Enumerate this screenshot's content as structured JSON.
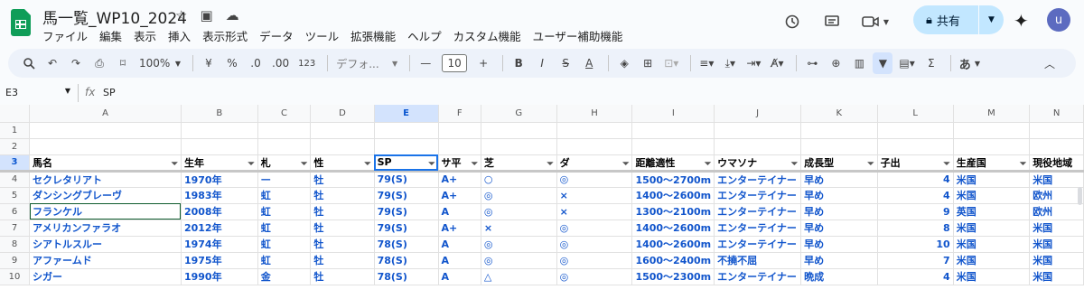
{
  "doc": {
    "title": "馬一覧_WP10_2024"
  },
  "menu": [
    "ファイル",
    "編集",
    "表示",
    "挿入",
    "表示形式",
    "データ",
    "ツール",
    "拡張機能",
    "ヘルプ",
    "カスタム機能",
    "ユーザー補助機能"
  ],
  "share": {
    "label": "共有"
  },
  "user": {
    "initial": "u"
  },
  "toolbar": {
    "zoom": "100%",
    "currency": "¥",
    "percent": "%",
    "dec_less": ".0",
    "dec_more": ".00",
    "number_format": "123",
    "font": "デフォ...",
    "font_size": "10",
    "bold": "B",
    "italic": "I",
    "strike": "S",
    "text_color": "A",
    "input_tool": "あ"
  },
  "formula": {
    "cell": "E3",
    "fx": "fx",
    "value": "SP"
  },
  "columns": [
    "A",
    "B",
    "C",
    "D",
    "E",
    "F",
    "G",
    "H",
    "I",
    "J",
    "K",
    "L",
    "M",
    "N"
  ],
  "row_numbers": [
    "1",
    "2",
    "3",
    "4",
    "5",
    "6",
    "7",
    "8",
    "9",
    "10"
  ],
  "headers": [
    "馬名",
    "生年",
    "札",
    "性",
    "SP",
    "サ平",
    "芝",
    "ダ",
    "距離適性",
    "ウマソナ",
    "成長型",
    "子出",
    "生産国",
    "現役地域"
  ],
  "rows": [
    [
      "セクレタリアト",
      "1970年",
      "—",
      "牡",
      "79(S)",
      "A+",
      "○",
      "◎",
      "1500〜2700m",
      "エンターテイナー",
      "早め",
      "4",
      "米国",
      "米国"
    ],
    [
      "ダンシングブレーヴ",
      "1983年",
      "虹",
      "牡",
      "79(S)",
      "A+",
      "◎",
      "×",
      "1400〜2600m",
      "エンターテイナー",
      "早め",
      "4",
      "米国",
      "欧州"
    ],
    [
      "フランケル",
      "2008年",
      "虹",
      "牡",
      "79(S)",
      "A",
      "◎",
      "×",
      "1300〜2100m",
      "エンターテイナー",
      "早め",
      "9",
      "英国",
      "欧州"
    ],
    [
      "アメリカンファラオ",
      "2012年",
      "虹",
      "牡",
      "79(S)",
      "A+",
      "×",
      "◎",
      "1400〜2600m",
      "エンターテイナー",
      "早め",
      "8",
      "米国",
      "米国"
    ],
    [
      "シアトルスルー",
      "1974年",
      "虹",
      "牡",
      "78(S)",
      "A",
      "◎",
      "◎",
      "1400〜2600m",
      "エンターテイナー",
      "早め",
      "10",
      "米国",
      "米国"
    ],
    [
      "アファームド",
      "1975年",
      "虹",
      "牡",
      "78(S)",
      "A",
      "◎",
      "◎",
      "1600〜2400m",
      "不撓不屈",
      "早め",
      "7",
      "米国",
      "米国"
    ],
    [
      "シガー",
      "1990年",
      "金",
      "牡",
      "78(S)",
      "A",
      "△",
      "◎",
      "1500〜2300m",
      "エンターテイナー",
      "晩成",
      "4",
      "米国",
      "米国"
    ]
  ]
}
